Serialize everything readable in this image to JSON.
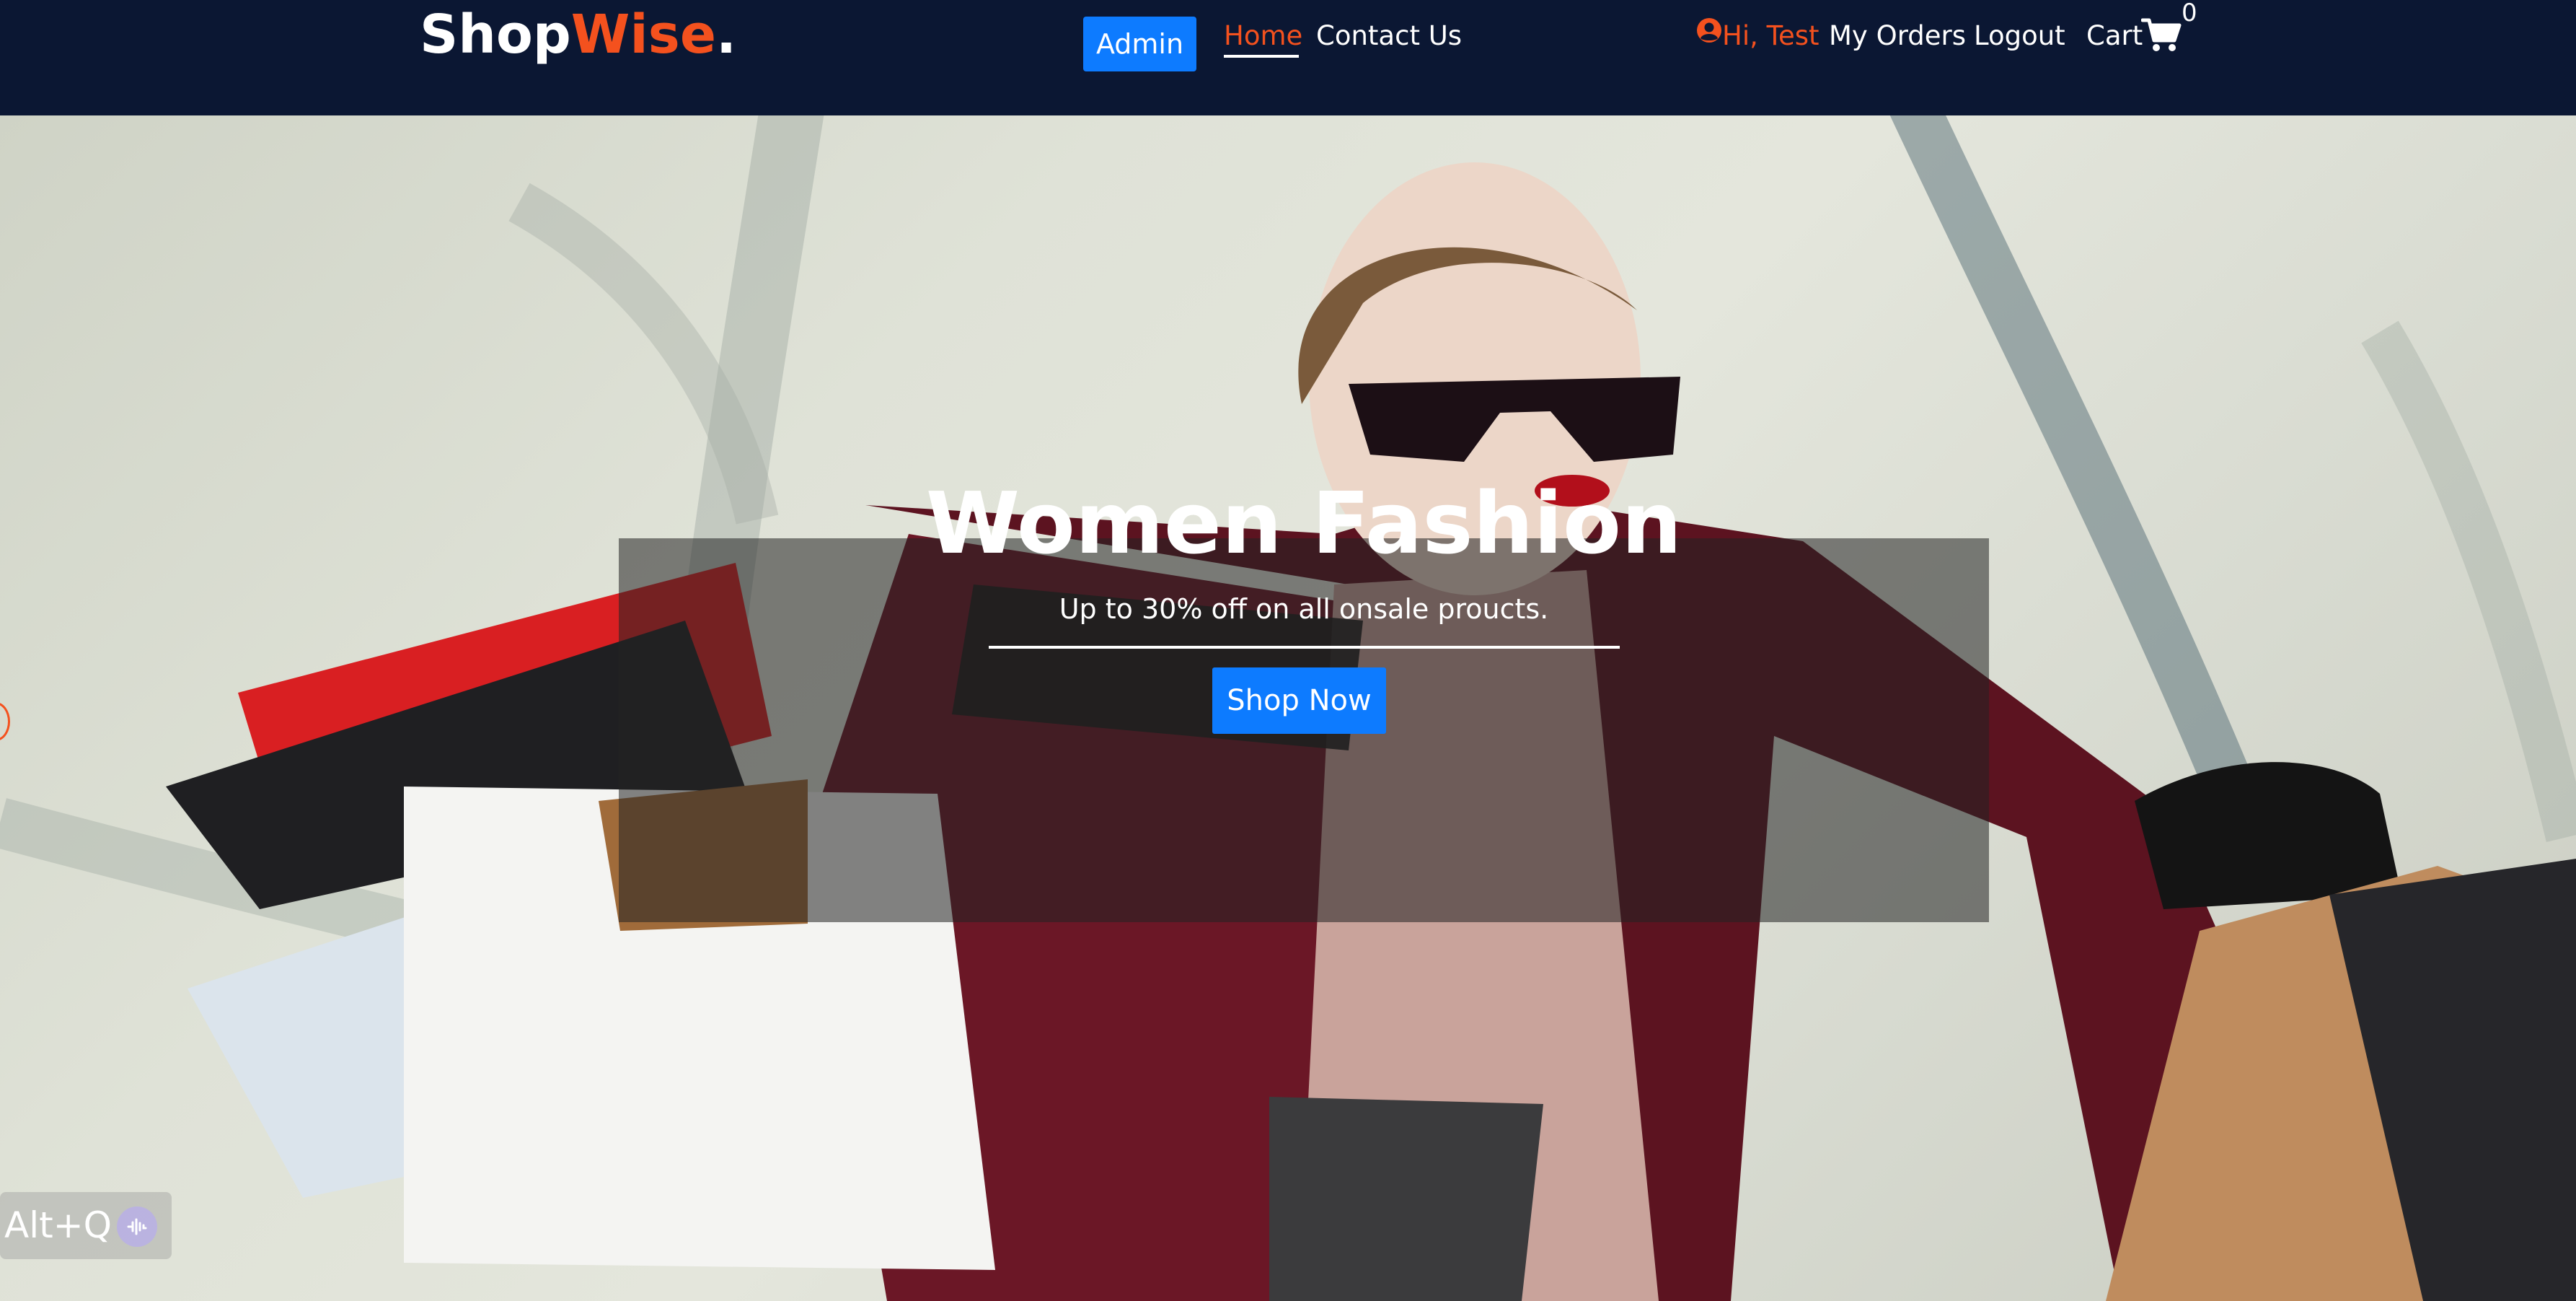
{
  "navbar": {
    "brand": {
      "part1": "Shop",
      "part2": "Wise",
      "dot": "."
    },
    "admin_label": "Admin",
    "links": [
      {
        "label": "Home",
        "active": true
      },
      {
        "label": "Contact Us",
        "active": false
      }
    ],
    "user_greeting": "Hi, Test",
    "my_orders_label": "My Orders",
    "logout_label": "Logout",
    "cart_label": "Cart",
    "cart_count": "0",
    "icons": {
      "user": "user-circle-icon",
      "cart": "shopping-cart-icon"
    }
  },
  "hero": {
    "title": "Women Fashion",
    "subtitle": "Up to 30% off on all onsale proucts.",
    "cta_label": "Shop Now"
  },
  "widget": {
    "label": "Alt+Q",
    "icon": "audio-wave-icon"
  },
  "colors": {
    "navbar_bg": "#0b1733",
    "accent_orange": "#f4511e",
    "primary_blue": "#0d7bff",
    "text_white": "#ffffff"
  }
}
